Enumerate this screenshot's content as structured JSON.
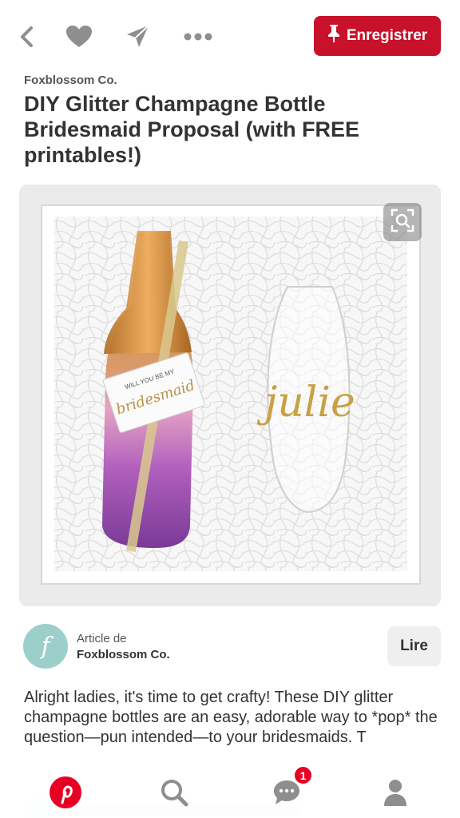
{
  "topbar": {
    "icons": [
      "back-arrow-icon",
      "heart-icon",
      "send-icon",
      "more-icon"
    ],
    "save_label": "Enregistrer",
    "save_color": "#c8112a"
  },
  "pin": {
    "source": "Foxblossom Co.",
    "title": "DIY Glitter Champagne Bottle Bridesmaid Proposal (with FREE printables!)",
    "image": {
      "tag_text_top": "WILL YOU BE MY",
      "tag_text_main": "bridesmaid",
      "glass_text": "julie"
    }
  },
  "article": {
    "label": "Article de",
    "source": "Foxblossom Co.",
    "avatar_letter": "f",
    "read_label": "Lire"
  },
  "description": "Alright ladies, it's time to get crafty! These DIY glitter champagne bottles are an easy, adorable way to *pop* the question—pun intended—to your bridesmaids. T",
  "bottom_nav": {
    "items": [
      "pinterest-logo-icon",
      "search-icon",
      "messages-icon",
      "profile-icon"
    ],
    "messages_badge": "1",
    "brand_color": "#e60023"
  }
}
